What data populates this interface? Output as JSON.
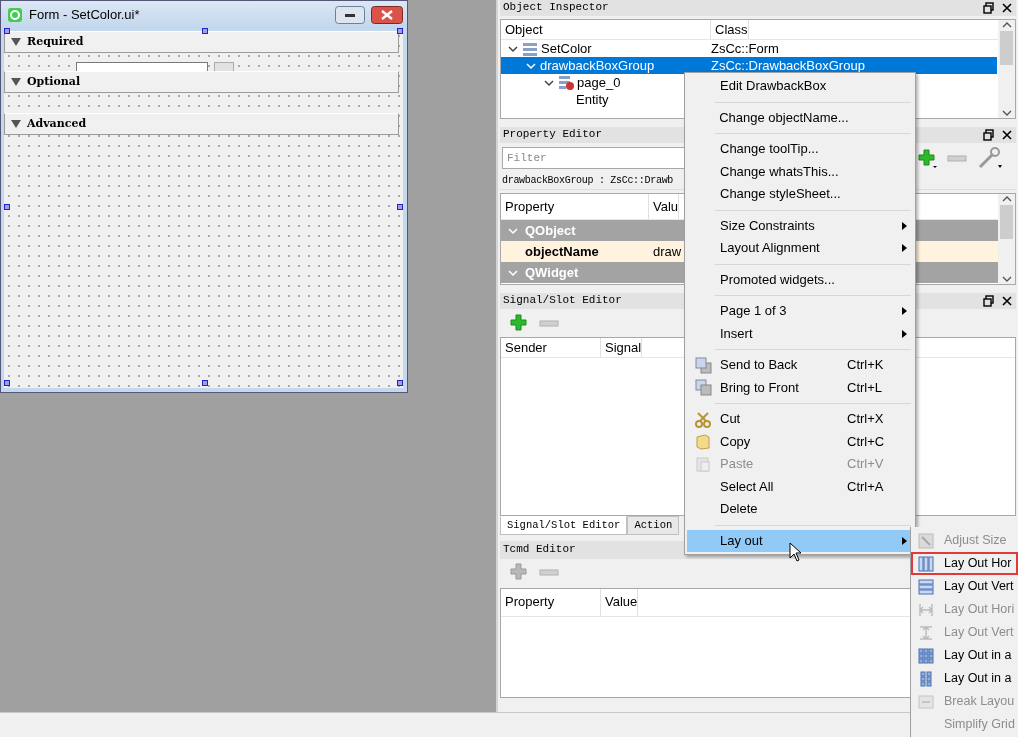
{
  "form_window": {
    "title": "Form - SetColor.ui*",
    "sections": [
      {
        "title": "Required",
        "expanded": true,
        "widgets": [
          {
            "kind": "line-edit"
          },
          {
            "kind": "button"
          }
        ]
      },
      {
        "title": "Optional",
        "expanded": true
      },
      {
        "title": "Advanced",
        "expanded": true
      }
    ]
  },
  "object_inspector": {
    "title": "Object Inspector",
    "columns": [
      "Object",
      "Class"
    ],
    "tree": [
      {
        "object": "SetColor",
        "class": "ZsCc::Form",
        "kind": "form",
        "expanded": true,
        "selected": false,
        "children": [
          {
            "object": "drawbackBoxGroup",
            "class": "ZsCc::DrawbackBoxGroup",
            "expanded": true,
            "selected": true,
            "children": [
              {
                "object": "page_0",
                "kind": "page",
                "expanded": true,
                "selected": false,
                "children": [
                  {
                    "object": "Entity",
                    "selected": false
                  }
                ]
              }
            ]
          }
        ]
      }
    ]
  },
  "property_editor": {
    "title": "Property Editor",
    "filter": {
      "placeholder": "Filter"
    },
    "object_label": "drawbackBoxGroup : ZsCc::Drawb",
    "columns": [
      "Property",
      "Valu"
    ],
    "rows": [
      {
        "kind": "group",
        "name": "QObject",
        "expanded": true
      },
      {
        "kind": "property",
        "name": "objectName",
        "value": "draw"
      },
      {
        "kind": "group",
        "name": "QWidget",
        "expanded": true
      }
    ]
  },
  "signal_slot_editor": {
    "title": "Signal/Slot Editor",
    "toolbar": [
      {
        "kind": "add",
        "disabled": false
      },
      {
        "kind": "remove",
        "disabled": true
      }
    ],
    "columns": [
      "Sender",
      "Signal"
    ]
  },
  "dock_tabs": [
    {
      "label": "Signal/Slot Editor",
      "selected": true
    },
    {
      "label": "Action",
      "selected": false
    }
  ],
  "tcmd_editor": {
    "title": "Tcmd Editor",
    "toolbar": [
      {
        "kind": "add",
        "disabled": true
      },
      {
        "kind": "remove",
        "disabled": true
      }
    ],
    "columns": [
      "Property",
      "Value"
    ]
  },
  "context_menu": {
    "items": [
      {
        "kind": "plain",
        "label": "Edit DrawbackBox",
        "disabled": false,
        "selected": false
      },
      {
        "kind": "separator"
      },
      {
        "kind": "plain",
        "label": "Change objectName...",
        "disabled": false,
        "selected": false
      },
      {
        "kind": "separator"
      },
      {
        "kind": "plain",
        "label": "Change toolTip...",
        "disabled": false,
        "selected": false
      },
      {
        "kind": "plain",
        "label": "Change whatsThis...",
        "disabled": false,
        "selected": false
      },
      {
        "kind": "plain",
        "label": "Change styleSheet...",
        "disabled": false,
        "selected": false
      },
      {
        "kind": "separator"
      },
      {
        "kind": "submenu",
        "label": "Size Constraints",
        "disabled": false,
        "selected": false
      },
      {
        "kind": "submenu",
        "label": "Layout Alignment",
        "disabled": false,
        "selected": false
      },
      {
        "kind": "separator"
      },
      {
        "kind": "plain",
        "label": "Promoted widgets...",
        "disabled": false,
        "selected": false
      },
      {
        "kind": "separator"
      },
      {
        "kind": "submenu",
        "label": "Page 1 of 3",
        "disabled": false,
        "selected": false
      },
      {
        "kind": "submenu",
        "label": "Insert",
        "disabled": false,
        "selected": false
      },
      {
        "kind": "separator"
      },
      {
        "kind": "send-back",
        "label": "Send to Back",
        "shortcut": "Ctrl+K",
        "disabled": false,
        "selected": false
      },
      {
        "kind": "bring-front",
        "label": "Bring to Front",
        "shortcut": "Ctrl+L",
        "disabled": false,
        "selected": false
      },
      {
        "kind": "separator"
      },
      {
        "kind": "cut",
        "label": "Cut",
        "shortcut": "Ctrl+X",
        "disabled": false,
        "selected": false
      },
      {
        "kind": "copy",
        "label": "Copy",
        "shortcut": "Ctrl+C",
        "disabled": false,
        "selected": false
      },
      {
        "kind": "paste",
        "label": "Paste",
        "shortcut": "Ctrl+V",
        "disabled": true,
        "selected": false
      },
      {
        "kind": "plain",
        "label": "Select All",
        "shortcut": "Ctrl+A",
        "disabled": false,
        "selected": false
      },
      {
        "kind": "plain",
        "label": "Delete",
        "disabled": false,
        "selected": false
      },
      {
        "kind": "separator"
      },
      {
        "kind": "submenu",
        "label": "Lay out",
        "disabled": false,
        "selected": true
      }
    ]
  },
  "layout_submenu": {
    "items": [
      {
        "kind": "adjust",
        "label": "Adjust Size",
        "disabled": true,
        "highlighted": false
      },
      {
        "kind": "horizontal",
        "label": "Lay Out Hor",
        "disabled": false,
        "highlighted": true
      },
      {
        "kind": "vertical",
        "label": "Lay Out Vert",
        "disabled": false,
        "highlighted": false
      },
      {
        "kind": "split-horizontal",
        "label": "Lay Out Hori",
        "disabled": true,
        "highlighted": false
      },
      {
        "kind": "split-vertical",
        "label": "Lay Out Vert",
        "disabled": true,
        "highlighted": false
      },
      {
        "kind": "grid",
        "label": "Lay Out in a",
        "disabled": false,
        "highlighted": false
      },
      {
        "kind": "form-grid",
        "label": "Lay Out in a",
        "disabled": false,
        "highlighted": false
      },
      {
        "kind": "break",
        "label": "Break Layou",
        "disabled": true,
        "highlighted": false
      },
      {
        "kind": "plain",
        "label": "Simplify Grid",
        "disabled": true,
        "highlighted": false
      }
    ]
  }
}
